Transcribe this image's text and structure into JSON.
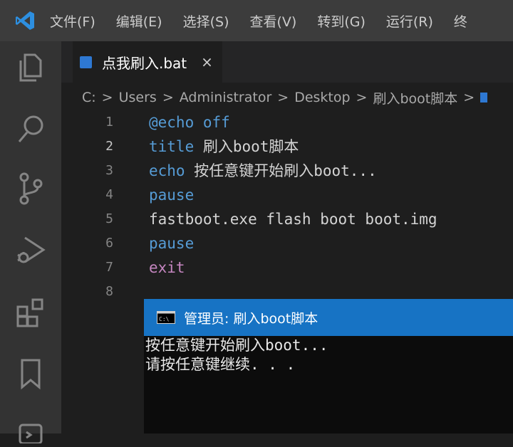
{
  "menu": {
    "items": [
      "文件(F)",
      "编辑(E)",
      "选择(S)",
      "查看(V)",
      "转到(G)",
      "运行(R)",
      "终"
    ]
  },
  "tab": {
    "label": "点我刷入.bat",
    "close": "×"
  },
  "breadcrumb": {
    "items": [
      "C:",
      "Users",
      "Administrator",
      "Desktop",
      "刷入boot脚本"
    ],
    "separator": ">"
  },
  "editor": {
    "active_line": 2,
    "lines": [
      {
        "num": "1",
        "tokens": [
          {
            "t": "kw",
            "s": "@echo off"
          }
        ]
      },
      {
        "num": "2",
        "tokens": [
          {
            "t": "kw",
            "s": "title"
          },
          {
            "t": "pl",
            "s": " 刷入boot脚本"
          }
        ]
      },
      {
        "num": "3",
        "tokens": [
          {
            "t": "kw",
            "s": "echo"
          },
          {
            "t": "pl",
            "s": " 按任意键开始刷入boot..."
          }
        ]
      },
      {
        "num": "4",
        "tokens": [
          {
            "t": "kw",
            "s": "pause"
          }
        ]
      },
      {
        "num": "5",
        "tokens": [
          {
            "t": "pl",
            "s": "fastboot.exe flash boot boot.img"
          }
        ]
      },
      {
        "num": "6",
        "tokens": [
          {
            "t": "kw",
            "s": "pause"
          }
        ]
      },
      {
        "num": "7",
        "tokens": [
          {
            "t": "ctl",
            "s": "exit"
          }
        ]
      },
      {
        "num": "8",
        "tokens": []
      }
    ]
  },
  "console": {
    "title": "管理员: 刷入boot脚本",
    "lines": [
      "按任意键开始刷入boot...",
      "请按任意键继续. . ."
    ]
  },
  "colors": {
    "menubar": "#3c3c3c",
    "activitybar": "#333333",
    "editor_bg": "#1e1e1e",
    "keyword": "#569cd6",
    "control": "#c586c0",
    "console_title": "#1773c4"
  },
  "activity_icons": [
    "explorer-icon",
    "search-icon",
    "source-control-icon",
    "run-debug-icon",
    "extensions-icon",
    "bookmark-icon",
    "remote-icon"
  ]
}
